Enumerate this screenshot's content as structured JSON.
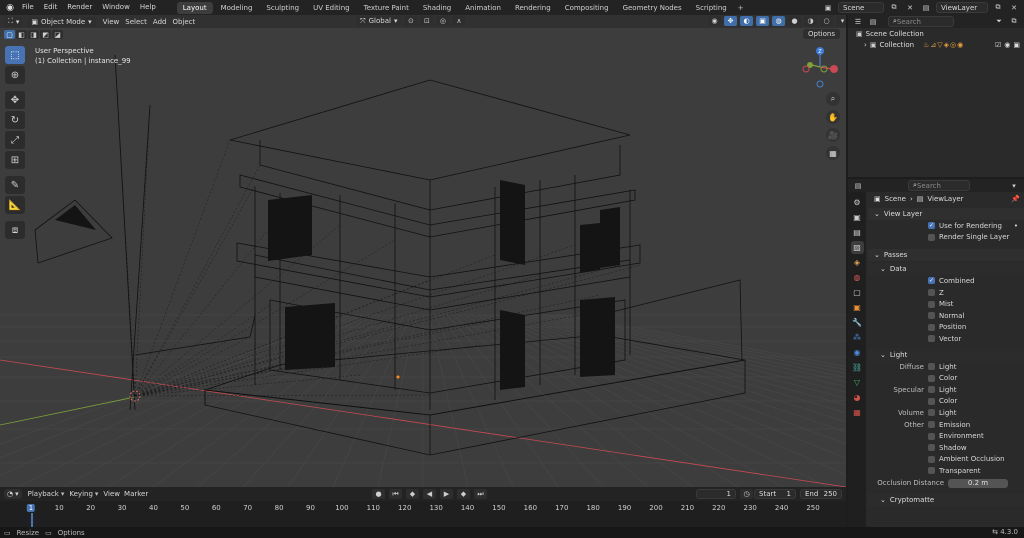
{
  "menu": [
    "File",
    "Edit",
    "Render",
    "Window",
    "Help"
  ],
  "workspaces": [
    "Layout",
    "Modeling",
    "Sculpting",
    "UV Editing",
    "Texture Paint",
    "Shading",
    "Animation",
    "Rendering",
    "Compositing",
    "Geometry Nodes",
    "Scripting"
  ],
  "workspace_add": "+",
  "scene_field": "Scene",
  "viewlayer_field": "ViewLayer",
  "viewport": {
    "mode": "Object Mode",
    "menus": [
      "View",
      "Select",
      "Add",
      "Object"
    ],
    "orientation": "Global",
    "options": "Options",
    "info_line1": "User Perspective",
    "info_line2": "(1) Collection | instance_99",
    "gizmo_z": "Z"
  },
  "outliner": {
    "search_placeholder": "Search",
    "scene_collection": "Scene Collection",
    "collection": "Collection"
  },
  "properties": {
    "search_placeholder": "Search",
    "crumb_scene": "Scene",
    "crumb_viewlayer": "ViewLayer",
    "view_layer": "View Layer",
    "use_for_rendering": "Use for Rendering",
    "render_single_layer": "Render Single Layer",
    "passes": "Passes",
    "data": "Data",
    "data_items": [
      {
        "label": "Combined",
        "checked": true
      },
      {
        "label": "Z",
        "checked": false
      },
      {
        "label": "Mist",
        "checked": false
      },
      {
        "label": "Normal",
        "checked": false
      },
      {
        "label": "Position",
        "checked": false
      },
      {
        "label": "Vector",
        "checked": false
      }
    ],
    "light": "Light",
    "diffuse": "Diffuse",
    "specular": "Specular",
    "volume": "Volume",
    "other": "Other",
    "light_item": "Light",
    "color_item": "Color",
    "other_items": [
      "Emission",
      "Environment",
      "Shadow",
      "Ambient Occlusion",
      "Transparent"
    ],
    "occlusion_distance": "Occlusion Distance",
    "occlusion_value": "0.2 m",
    "cryptomatte": "Cryptomatte"
  },
  "timeline": {
    "menus": [
      "Playback",
      "Keying",
      "View",
      "Marker"
    ],
    "current_frame": "1",
    "start_label": "Start",
    "start_value": "1",
    "end_label": "End",
    "end_value": "250",
    "ticks": [
      "1",
      "10",
      "20",
      "30",
      "40",
      "50",
      "60",
      "70",
      "80",
      "90",
      "100",
      "110",
      "120",
      "130",
      "140",
      "150",
      "160",
      "170",
      "180",
      "190",
      "200",
      "210",
      "220",
      "230",
      "240",
      "250"
    ]
  },
  "statusbar": {
    "resize": "Resize",
    "options": "Options",
    "version": "4.3.0"
  },
  "colors": {
    "accent": "#4772b3",
    "viewport_bg": "#3d3d3d",
    "wire": "#111111",
    "axis_x": "#c94a55",
    "axis_y": "#7ca33a"
  }
}
